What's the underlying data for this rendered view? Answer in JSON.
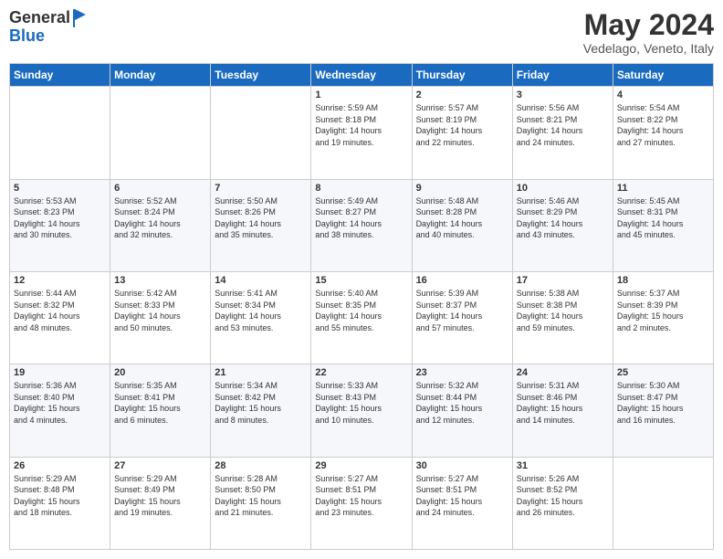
{
  "header": {
    "logo_line1": "General",
    "logo_line2": "Blue",
    "title": "May 2024",
    "location": "Vedelago, Veneto, Italy"
  },
  "days_of_week": [
    "Sunday",
    "Monday",
    "Tuesday",
    "Wednesday",
    "Thursday",
    "Friday",
    "Saturday"
  ],
  "weeks": [
    {
      "days": [
        {
          "num": "",
          "info": ""
        },
        {
          "num": "",
          "info": ""
        },
        {
          "num": "",
          "info": ""
        },
        {
          "num": "1",
          "info": "Sunrise: 5:59 AM\nSunset: 8:18 PM\nDaylight: 14 hours\nand 19 minutes."
        },
        {
          "num": "2",
          "info": "Sunrise: 5:57 AM\nSunset: 8:19 PM\nDaylight: 14 hours\nand 22 minutes."
        },
        {
          "num": "3",
          "info": "Sunrise: 5:56 AM\nSunset: 8:21 PM\nDaylight: 14 hours\nand 24 minutes."
        },
        {
          "num": "4",
          "info": "Sunrise: 5:54 AM\nSunset: 8:22 PM\nDaylight: 14 hours\nand 27 minutes."
        }
      ]
    },
    {
      "days": [
        {
          "num": "5",
          "info": "Sunrise: 5:53 AM\nSunset: 8:23 PM\nDaylight: 14 hours\nand 30 minutes."
        },
        {
          "num": "6",
          "info": "Sunrise: 5:52 AM\nSunset: 8:24 PM\nDaylight: 14 hours\nand 32 minutes."
        },
        {
          "num": "7",
          "info": "Sunrise: 5:50 AM\nSunset: 8:26 PM\nDaylight: 14 hours\nand 35 minutes."
        },
        {
          "num": "8",
          "info": "Sunrise: 5:49 AM\nSunset: 8:27 PM\nDaylight: 14 hours\nand 38 minutes."
        },
        {
          "num": "9",
          "info": "Sunrise: 5:48 AM\nSunset: 8:28 PM\nDaylight: 14 hours\nand 40 minutes."
        },
        {
          "num": "10",
          "info": "Sunrise: 5:46 AM\nSunset: 8:29 PM\nDaylight: 14 hours\nand 43 minutes."
        },
        {
          "num": "11",
          "info": "Sunrise: 5:45 AM\nSunset: 8:31 PM\nDaylight: 14 hours\nand 45 minutes."
        }
      ]
    },
    {
      "days": [
        {
          "num": "12",
          "info": "Sunrise: 5:44 AM\nSunset: 8:32 PM\nDaylight: 14 hours\nand 48 minutes."
        },
        {
          "num": "13",
          "info": "Sunrise: 5:42 AM\nSunset: 8:33 PM\nDaylight: 14 hours\nand 50 minutes."
        },
        {
          "num": "14",
          "info": "Sunrise: 5:41 AM\nSunset: 8:34 PM\nDaylight: 14 hours\nand 53 minutes."
        },
        {
          "num": "15",
          "info": "Sunrise: 5:40 AM\nSunset: 8:35 PM\nDaylight: 14 hours\nand 55 minutes."
        },
        {
          "num": "16",
          "info": "Sunrise: 5:39 AM\nSunset: 8:37 PM\nDaylight: 14 hours\nand 57 minutes."
        },
        {
          "num": "17",
          "info": "Sunrise: 5:38 AM\nSunset: 8:38 PM\nDaylight: 14 hours\nand 59 minutes."
        },
        {
          "num": "18",
          "info": "Sunrise: 5:37 AM\nSunset: 8:39 PM\nDaylight: 15 hours\nand 2 minutes."
        }
      ]
    },
    {
      "days": [
        {
          "num": "19",
          "info": "Sunrise: 5:36 AM\nSunset: 8:40 PM\nDaylight: 15 hours\nand 4 minutes."
        },
        {
          "num": "20",
          "info": "Sunrise: 5:35 AM\nSunset: 8:41 PM\nDaylight: 15 hours\nand 6 minutes."
        },
        {
          "num": "21",
          "info": "Sunrise: 5:34 AM\nSunset: 8:42 PM\nDaylight: 15 hours\nand 8 minutes."
        },
        {
          "num": "22",
          "info": "Sunrise: 5:33 AM\nSunset: 8:43 PM\nDaylight: 15 hours\nand 10 minutes."
        },
        {
          "num": "23",
          "info": "Sunrise: 5:32 AM\nSunset: 8:44 PM\nDaylight: 15 hours\nand 12 minutes."
        },
        {
          "num": "24",
          "info": "Sunrise: 5:31 AM\nSunset: 8:46 PM\nDaylight: 15 hours\nand 14 minutes."
        },
        {
          "num": "25",
          "info": "Sunrise: 5:30 AM\nSunset: 8:47 PM\nDaylight: 15 hours\nand 16 minutes."
        }
      ]
    },
    {
      "days": [
        {
          "num": "26",
          "info": "Sunrise: 5:29 AM\nSunset: 8:48 PM\nDaylight: 15 hours\nand 18 minutes."
        },
        {
          "num": "27",
          "info": "Sunrise: 5:29 AM\nSunset: 8:49 PM\nDaylight: 15 hours\nand 19 minutes."
        },
        {
          "num": "28",
          "info": "Sunrise: 5:28 AM\nSunset: 8:50 PM\nDaylight: 15 hours\nand 21 minutes."
        },
        {
          "num": "29",
          "info": "Sunrise: 5:27 AM\nSunset: 8:51 PM\nDaylight: 15 hours\nand 23 minutes."
        },
        {
          "num": "30",
          "info": "Sunrise: 5:27 AM\nSunset: 8:51 PM\nDaylight: 15 hours\nand 24 minutes."
        },
        {
          "num": "31",
          "info": "Sunrise: 5:26 AM\nSunset: 8:52 PM\nDaylight: 15 hours\nand 26 minutes."
        },
        {
          "num": "",
          "info": ""
        }
      ]
    }
  ]
}
